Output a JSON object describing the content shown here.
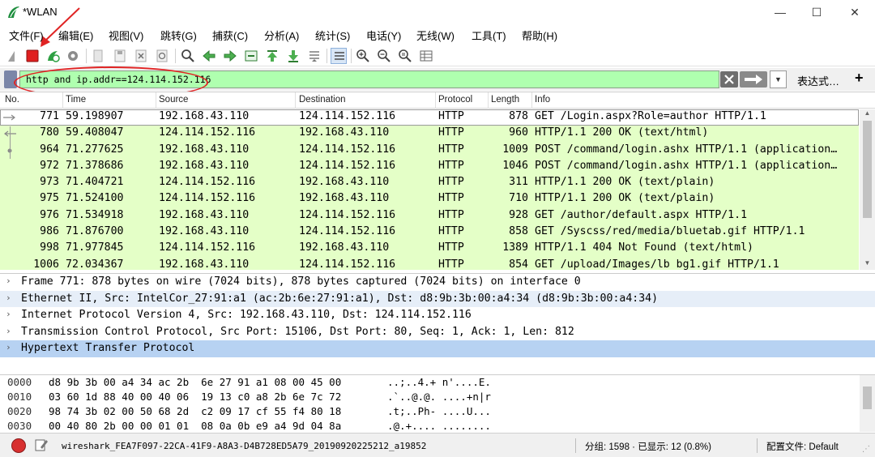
{
  "window": {
    "title": "*WLAN",
    "min_label": "—",
    "max_label": "☐",
    "close_label": "✕"
  },
  "menu": [
    "文件(F)",
    "编辑(E)",
    "视图(V)",
    "跳转(G)",
    "捕获(C)",
    "分析(A)",
    "统计(S)",
    "电话(Y)",
    "无线(W)",
    "工具(T)",
    "帮助(H)"
  ],
  "toolbar_icons": [
    "shark-fin-icon",
    "stop-capture-icon",
    "restart-capture-icon",
    "capture-options-icon",
    "open-file-icon",
    "save-file-icon",
    "close-file-icon",
    "reload-file-icon",
    "find-packet-icon",
    "go-back-icon",
    "go-forward-icon",
    "go-to-packet-icon",
    "first-packet-icon",
    "last-packet-icon",
    "auto-scroll-icon",
    "colorize-icon",
    "zoom-in-icon",
    "zoom-out-icon",
    "normal-size-icon",
    "resize-columns-icon"
  ],
  "filter": {
    "value": "http and ip.addr==124.114.152.116",
    "expression_label": "表达式…",
    "add_label": "+",
    "history_label": "▼"
  },
  "colors": {
    "accent_red": "#e02424",
    "row_green": "#e4ffc7",
    "filter_green": "#afffaf",
    "selection_blue": "#b7d2f2"
  },
  "packet_list": {
    "columns": [
      "No.",
      "Time",
      "Source",
      "Destination",
      "Protocol",
      "Length",
      "Info"
    ],
    "rows": [
      {
        "no": "771",
        "time": "59.198907",
        "src": "192.168.43.110",
        "dst": "124.114.152.116",
        "proto": "HTTP",
        "len": "878",
        "info": "GET /Login.aspx?Role=author HTTP/1.1"
      },
      {
        "no": "780",
        "time": "59.408047",
        "src": "124.114.152.116",
        "dst": "192.168.43.110",
        "proto": "HTTP",
        "len": "960",
        "info": "HTTP/1.1 200 OK  (text/html)"
      },
      {
        "no": "964",
        "time": "71.277625",
        "src": "192.168.43.110",
        "dst": "124.114.152.116",
        "proto": "HTTP",
        "len": "1009",
        "info": "POST /command/login.ashx HTTP/1.1  (application…"
      },
      {
        "no": "972",
        "time": "71.378686",
        "src": "192.168.43.110",
        "dst": "124.114.152.116",
        "proto": "HTTP",
        "len": "1046",
        "info": "POST /command/login.ashx HTTP/1.1  (application…"
      },
      {
        "no": "973",
        "time": "71.404721",
        "src": "124.114.152.116",
        "dst": "192.168.43.110",
        "proto": "HTTP",
        "len": "311",
        "info": "HTTP/1.1 200 OK  (text/plain)"
      },
      {
        "no": "975",
        "time": "71.524100",
        "src": "124.114.152.116",
        "dst": "192.168.43.110",
        "proto": "HTTP",
        "len": "710",
        "info": "HTTP/1.1 200 OK  (text/plain)"
      },
      {
        "no": "976",
        "time": "71.534918",
        "src": "192.168.43.110",
        "dst": "124.114.152.116",
        "proto": "HTTP",
        "len": "928",
        "info": "GET /author/default.aspx HTTP/1.1"
      },
      {
        "no": "986",
        "time": "71.876700",
        "src": "192.168.43.110",
        "dst": "124.114.152.116",
        "proto": "HTTP",
        "len": "858",
        "info": "GET /Syscss/red/media/bluetab.gif HTTP/1.1"
      },
      {
        "no": "998",
        "time": "71.977845",
        "src": "124.114.152.116",
        "dst": "192.168.43.110",
        "proto": "HTTP",
        "len": "1389",
        "info": "HTTP/1.1 404 Not Found  (text/html)"
      },
      {
        "no": "1006",
        "time": "72.034367",
        "src": "192.168.43.110",
        "dst": "124.114.152.116",
        "proto": "HTTP",
        "len": "854",
        "info": "GET /upload/Images/lb bg1.gif HTTP/1.1"
      }
    ]
  },
  "details": [
    {
      "arrow": "›",
      "text": "Frame 771: 878 bytes on wire (7024 bits), 878 bytes captured (7024 bits) on interface 0"
    },
    {
      "arrow": "›",
      "text": "Ethernet II, Src: IntelCor_27:91:a1 (ac:2b:6e:27:91:a1), Dst: d8:9b:3b:00:a4:34 (d8:9b:3b:00:a4:34)"
    },
    {
      "arrow": "›",
      "text": "Internet Protocol Version 4, Src: 192.168.43.110, Dst: 124.114.152.116"
    },
    {
      "arrow": "›",
      "text": "Transmission Control Protocol, Src Port: 15106, Dst Port: 80, Seq: 1, Ack: 1, Len: 812"
    },
    {
      "arrow": "›",
      "text": "Hypertext Transfer Protocol"
    }
  ],
  "bytes": [
    {
      "offset": "0000",
      "hex": "d8 9b 3b 00 a4 34 ac 2b  6e 27 91 a1 08 00 45 00",
      "ascii": "..;..4.+ n'....E."
    },
    {
      "offset": "0010",
      "hex": "03 60 1d 88 40 00 40 06  19 13 c0 a8 2b 6e 7c 72",
      "ascii": ".`..@.@. ....+n|r"
    },
    {
      "offset": "0020",
      "hex": "98 74 3b 02 00 50 68 2d  c2 09 17 cf 55 f4 80 18",
      "ascii": ".t;..Ph- ....U..."
    },
    {
      "offset": "0030",
      "hex": "00 40 80 2b 00 00 01 01  08 0a 0b e9 a4 9d 04 8a",
      "ascii": ".@.+.... ........"
    }
  ],
  "status": {
    "file": "wireshark_FEA7F097-22CA-41F9-A8A3-D4B728ED5A79_20190920225212_a19852",
    "packets": "分组: 1598 · 已显示: 12 (0.8%)",
    "profile": "配置文件: Default"
  }
}
